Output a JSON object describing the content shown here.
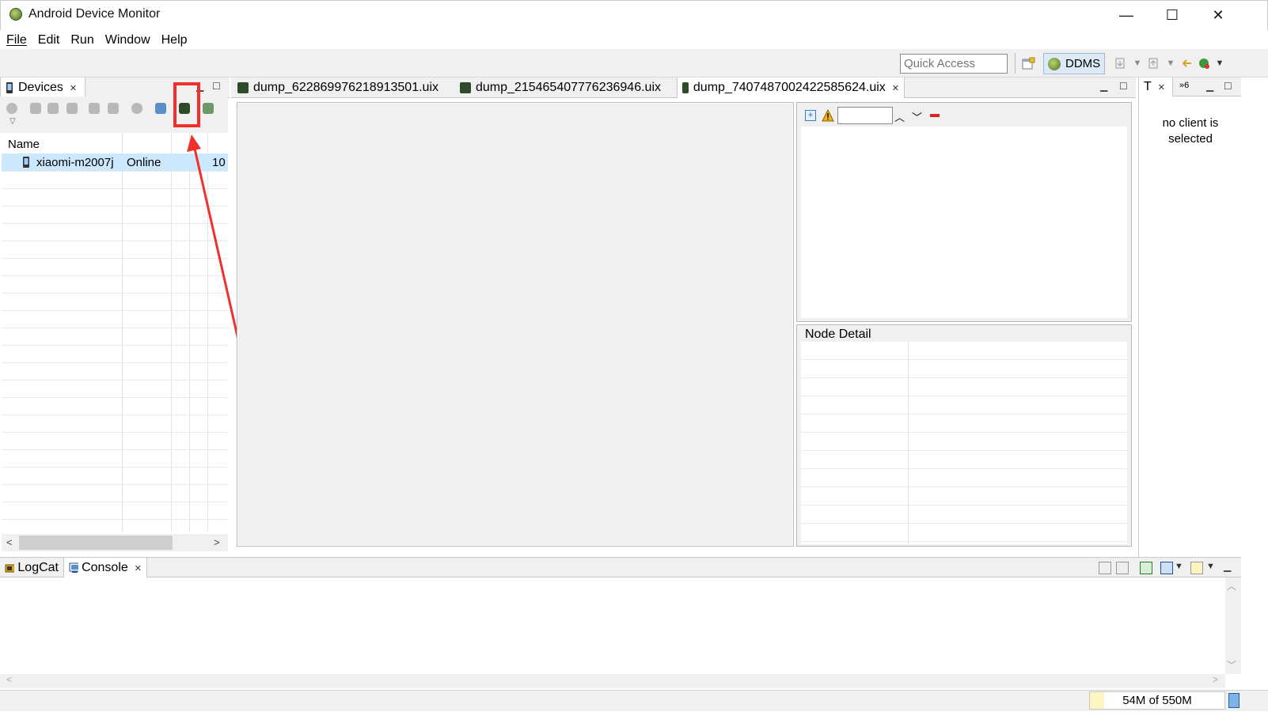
{
  "window": {
    "title": "Android Device Monitor",
    "minimize": "—",
    "maximize": "☐",
    "close": "✕"
  },
  "menu": [
    {
      "label": "File",
      "mnemonic": "F"
    },
    {
      "label": "Edit",
      "mnemonic": "E"
    },
    {
      "label": "Run",
      "mnemonic": "R"
    },
    {
      "label": "Window",
      "mnemonic": "W"
    },
    {
      "label": "Help",
      "mnemonic": "H"
    }
  ],
  "toolbar": {
    "quick_access_placeholder": "Quick Access",
    "perspective": "DDMS"
  },
  "devices": {
    "tab_label": "Devices",
    "column_name": "Name",
    "device_name": "xiaomi-m2007j",
    "device_status": "Online",
    "device_extra": "10"
  },
  "editor_tabs": [
    "dump_6228699762189135 01.uix",
    "dump_215465407776236946.uix",
    "dump_7407487002422585624.uix"
  ],
  "hierarchy": {
    "node_detail_title": "Node Detail"
  },
  "right_panel": {
    "tab_label": "T",
    "overflow_label": "»6",
    "message": "no client is selected"
  },
  "bottom": {
    "logcat_label": "LogCat",
    "console_label": "Console"
  },
  "status": {
    "heap": "54M of 550M"
  },
  "colors": {
    "highlight": "#f0302a",
    "selected_row": "#cce8ff",
    "ddms_bg": "#dde9f5"
  }
}
